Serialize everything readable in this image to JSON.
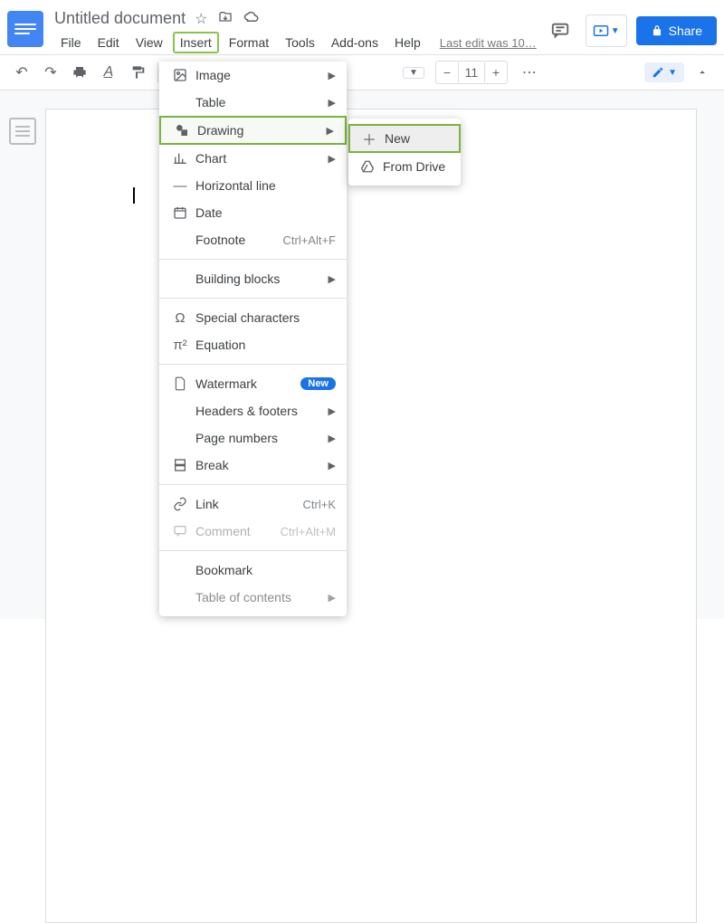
{
  "header": {
    "doc_title": "Untitled document",
    "last_edit": "Last edit was 10…",
    "menus": {
      "file": "File",
      "edit": "Edit",
      "view": "View",
      "insert": "Insert",
      "format": "Format",
      "tools": "Tools",
      "addons": "Add-ons",
      "help": "Help"
    },
    "share_label": "Share"
  },
  "toolbar": {
    "font_size": "11"
  },
  "insert_menu": {
    "image": "Image",
    "table": "Table",
    "drawing": "Drawing",
    "chart": "Chart",
    "hline": "Horizontal line",
    "date": "Date",
    "footnote": "Footnote",
    "footnote_sc": "Ctrl+Alt+F",
    "building_blocks": "Building blocks",
    "special_chars": "Special characters",
    "equation": "Equation",
    "watermark": "Watermark",
    "watermark_badge": "New",
    "headers_footers": "Headers & footers",
    "page_numbers": "Page numbers",
    "break": "Break",
    "link": "Link",
    "link_sc": "Ctrl+K",
    "comment": "Comment",
    "comment_sc": "Ctrl+Alt+M",
    "bookmark": "Bookmark",
    "toc": "Table of contents"
  },
  "drawing_submenu": {
    "new": "New",
    "from_drive": "From Drive"
  }
}
